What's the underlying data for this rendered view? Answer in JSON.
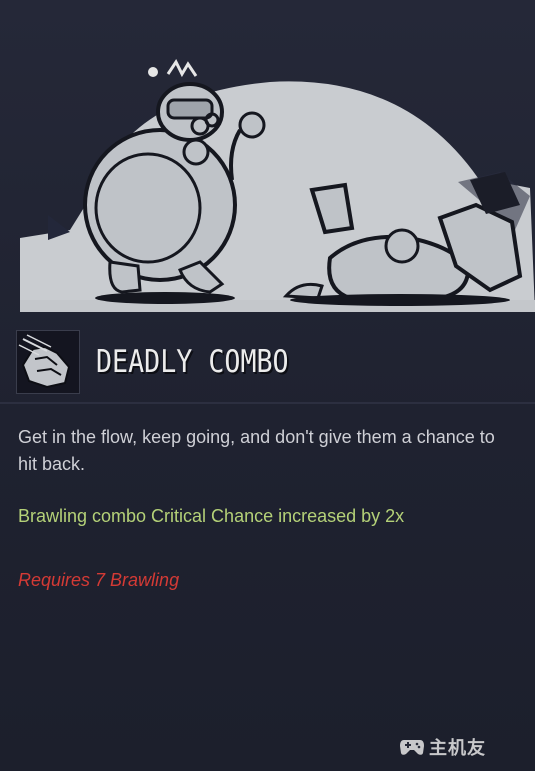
{
  "skill": {
    "title": "DEADLY COMBO",
    "icon": "fist-combo-icon",
    "description": "Get in the flow, keep going, and don't give them a chance to hit back.",
    "effect": "Brawling combo Critical Chance increased by 2x",
    "requirement": "Requires 7 Brawling"
  },
  "art": {
    "icon": "brawler-illustration",
    "background_color": "#c9ccd0"
  },
  "colors": {
    "effect": "#b4d178",
    "requirement": "#d43a35",
    "description": "#cfd0d6",
    "title": "#ececec",
    "background": "#1f2231"
  },
  "watermark": {
    "text": "主机友",
    "icon": "gamepad-icon"
  }
}
